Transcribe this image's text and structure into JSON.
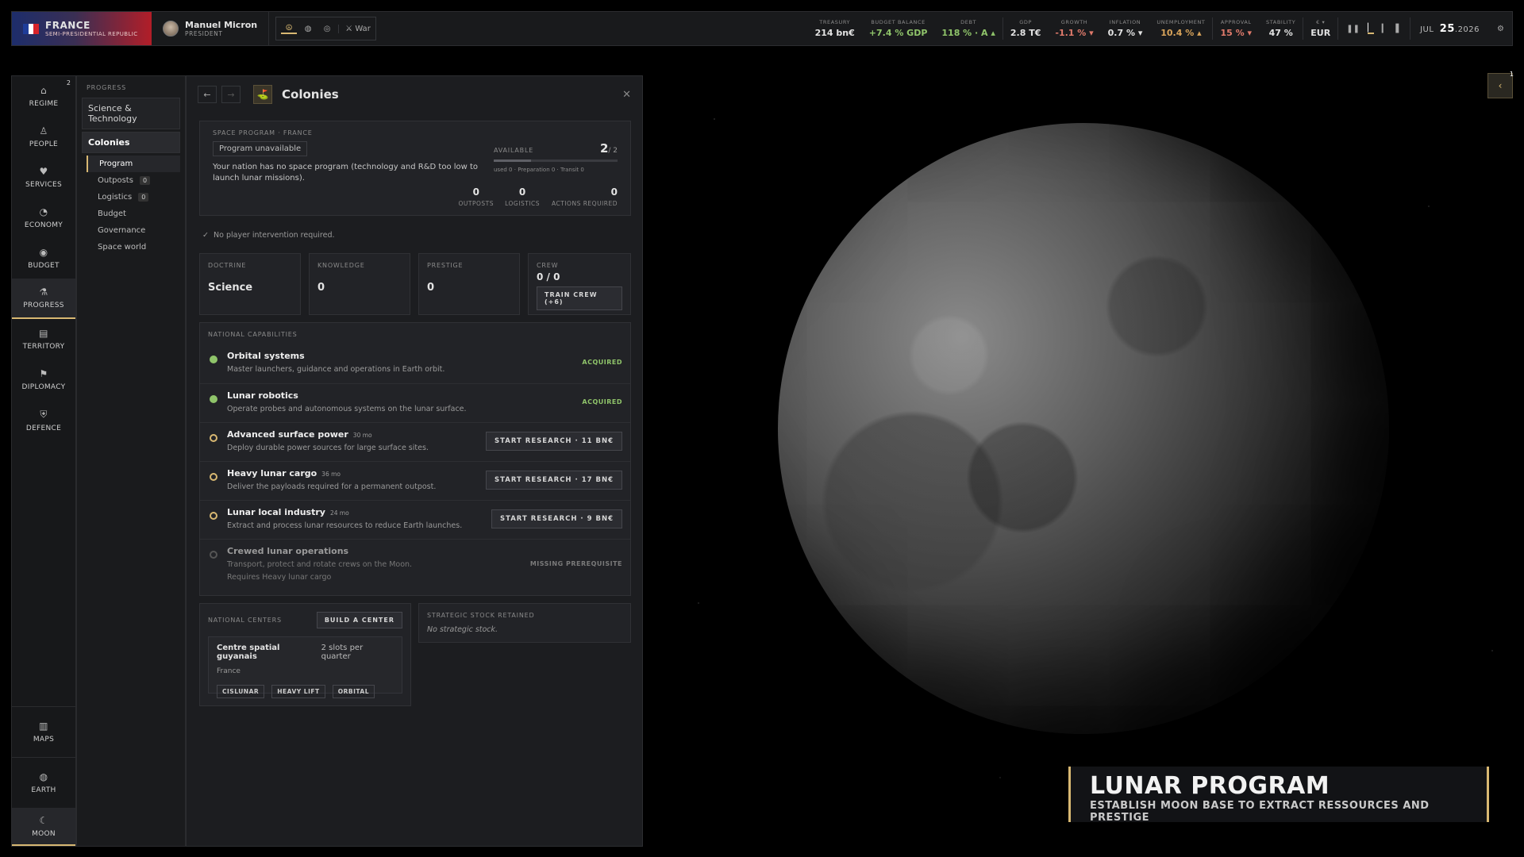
{
  "topbar": {
    "country_name": "FRANCE",
    "country_type": "SEMI-PRESIDENTIAL REPUBLIC",
    "flag_colors": [
      "#1f3d99",
      "#ffffff",
      "#d8232a"
    ],
    "leader_name": "Manuel Micron",
    "leader_role": "PRESIDENT",
    "mode_war": "War",
    "stats": [
      {
        "label": "TREASURY",
        "value": "214 bn€",
        "tone": ""
      },
      {
        "label": "BUDGET BALANCE",
        "value": "+7.4 % GDP",
        "tone": "g"
      },
      {
        "label": "DEBT",
        "value": "118 % · A ▴",
        "tone": "g"
      },
      {
        "label": "GDP",
        "value": "2.8 T€",
        "tone": ""
      },
      {
        "label": "GROWTH",
        "value": "-1.1 % ▾",
        "tone": "r"
      },
      {
        "label": "INFLATION",
        "value": "0.7 % ▾",
        "tone": ""
      },
      {
        "label": "UNEMPLOYMENT",
        "value": "10.4 % ▴",
        "tone": "o"
      },
      {
        "label": "APPROVAL",
        "value": "15 % ▾",
        "tone": "r"
      },
      {
        "label": "STABILITY",
        "value": "47 %",
        "tone": ""
      }
    ],
    "currency_symbol": "€ ▾",
    "currency": "EUR",
    "date_month": "JUL",
    "date_day": "25",
    "date_year": ".2026"
  },
  "leftnav": {
    "badge": "2",
    "items": [
      "REGIME",
      "PEOPLE",
      "SERVICES",
      "ECONOMY",
      "BUDGET",
      "PROGRESS",
      "TERRITORY",
      "DIPLOMACY",
      "DEFENCE"
    ],
    "bottom": [
      "MAPS",
      "EARTH",
      "MOON"
    ]
  },
  "subnav": {
    "heading": "PROGRESS",
    "science": "Science & Technology",
    "colonies": "Colonies",
    "items": [
      {
        "label": "Program",
        "count": ""
      },
      {
        "label": "Outposts",
        "count": "0"
      },
      {
        "label": "Logistics",
        "count": "0"
      },
      {
        "label": "Budget",
        "count": ""
      },
      {
        "label": "Governance",
        "count": ""
      },
      {
        "label": "Space world",
        "count": ""
      }
    ]
  },
  "panel": {
    "title": "Colonies",
    "program": {
      "label": "SPACE PROGRAM · FRANCE",
      "status": "Program unavailable",
      "description": "Your nation has no space program (technology and R&D too low to launch lunar missions).",
      "available_label": "AVAILABLE",
      "available_value": "2",
      "available_total": "/ 2",
      "available_fraction": 0.3,
      "usage": "used 0 · Preparation 0 · Transit 0",
      "outposts": "0",
      "outposts_label": "OUTPOSTS",
      "logistics": "0",
      "logistics_label": "LOGISTICS",
      "actions": "0",
      "actions_label": "ACTIONS REQUIRED"
    },
    "intervention": "No player intervention required.",
    "tiles": {
      "doctrine_label": "DOCTRINE",
      "doctrine": "Science",
      "knowledge_label": "KNOWLEDGE",
      "knowledge": "0",
      "prestige_label": "PRESTIGE",
      "prestige": "0",
      "crew_label": "CREW",
      "crew": "0 / 0",
      "train_button": "TRAIN CREW (+6)"
    },
    "capabilities": {
      "heading": "NATIONAL CAPABILITIES",
      "items": [
        {
          "title": "Orbital systems",
          "duration": "",
          "desc": "Master launchers, guidance and operations in Earth orbit.",
          "status": "ACQUIRED",
          "button": ""
        },
        {
          "title": "Lunar robotics",
          "duration": "",
          "desc": "Operate probes and autonomous systems on the lunar surface.",
          "status": "ACQUIRED",
          "button": ""
        },
        {
          "title": "Advanced surface power",
          "duration": "30 mo",
          "desc": "Deploy durable power sources for large surface sites.",
          "status": "",
          "button": "START RESEARCH · 11 BN€"
        },
        {
          "title": "Heavy lunar cargo",
          "duration": "36 mo",
          "desc": "Deliver the payloads required for a permanent outpost.",
          "status": "",
          "button": "START RESEARCH · 17 BN€"
        },
        {
          "title": "Lunar local industry",
          "duration": "24 mo",
          "desc": "Extract and process lunar resources to reduce Earth launches.",
          "status": "",
          "button": "START RESEARCH · 9 BN€"
        }
      ],
      "locked": {
        "title": "Crewed lunar operations",
        "desc": "Transport, protect and rotate crews on the Moon.",
        "req": "Requires Heavy lunar cargo",
        "status": "MISSING PREREQUISITE"
      }
    },
    "centers": {
      "heading": "NATIONAL CENTERS",
      "build_button": "BUILD A CENTER",
      "name": "Centre spatial guyanais",
      "slots": "2 slots per quarter",
      "country": "France",
      "tags": [
        "CISLUNAR",
        "HEAVY LIFT",
        "ORBITAL"
      ]
    },
    "stock": {
      "heading": "STRATEGIC STOCK RETAINED",
      "value": "No strategic stock."
    }
  },
  "right_toggle_badge": "1",
  "banner": {
    "title": "LUNAR PROGRAM",
    "subtitle": "ESTABLISH MOON BASE TO EXTRACT RESSOURCES AND PRESTIGE"
  }
}
